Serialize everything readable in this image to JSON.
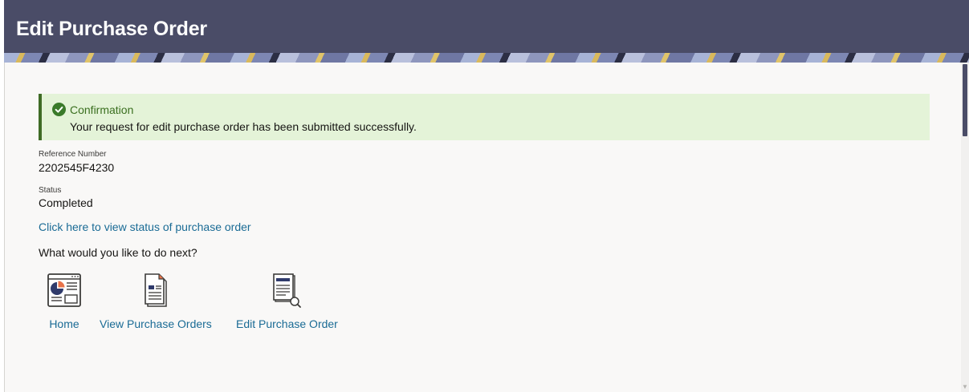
{
  "header": {
    "title": "Edit Purchase Order"
  },
  "confirmation": {
    "title": "Confirmation",
    "message": "Your request for edit purchase order has been submitted successfully.",
    "icon": "check-circle-icon",
    "accent_color": "#3f6b25",
    "background_color": "#e4f3d8"
  },
  "reference": {
    "label": "Reference Number",
    "value": "2202545F4230"
  },
  "status": {
    "label": "Status",
    "value": "Completed"
  },
  "status_link": "Click here to view status of purchase order",
  "next_prompt": "What would you like to do next?",
  "actions": [
    {
      "label": "Home",
      "icon": "dashboard-icon"
    },
    {
      "label": "View Purchase Orders",
      "icon": "document-list-icon"
    },
    {
      "label": "Edit Purchase Order",
      "icon": "document-search-icon"
    }
  ],
  "colors": {
    "header_bg": "#4a4c67",
    "link": "#1a6b95"
  }
}
